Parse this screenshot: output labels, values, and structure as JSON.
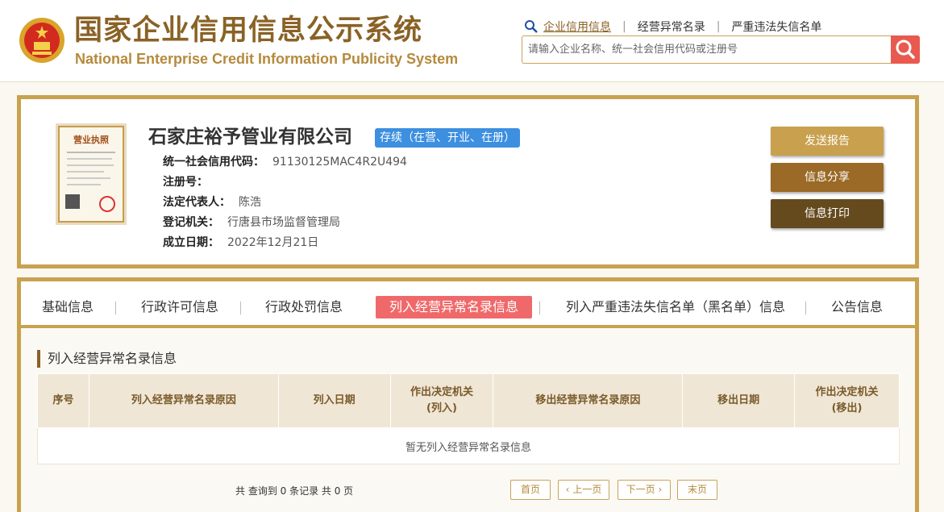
{
  "header": {
    "title_cn": "国家企业信用信息公示系统",
    "title_en": "National Enterprise Credit Information Publicity System",
    "nav": [
      "企业信用信息",
      "经营异常名录",
      "严重违法失信名单"
    ],
    "search_placeholder": "请输入企业名称、统一社会信用代码或注册号",
    "icons": {
      "emblem": "national-emblem-icon",
      "nav_search": "magnifier-icon",
      "search_button": "search-icon"
    }
  },
  "company": {
    "name": "石家庄裕予管业有限公司",
    "status": "存续（在营、开业、在册）",
    "license_image_title": "营业执照",
    "fields": [
      {
        "label": "统一社会信用代码：",
        "value": "91130125MAC4R2U494"
      },
      {
        "label": "注册号：",
        "value": ""
      },
      {
        "label": "法定代表人：",
        "value": "陈浩"
      },
      {
        "label": "登记机关：",
        "value": "行唐县市场监督管理局"
      },
      {
        "label": "成立日期：",
        "value": "2022年12月21日"
      }
    ],
    "actions": [
      {
        "label": "发送报告",
        "color": "#c9a04e"
      },
      {
        "label": "信息分享",
        "color": "#9a6a26"
      },
      {
        "label": "信息打印",
        "color": "#654a1e"
      }
    ]
  },
  "tabs": [
    {
      "label": "基础信息",
      "active": false
    },
    {
      "label": "行政许可信息",
      "active": false
    },
    {
      "label": "行政处罚信息",
      "active": false
    },
    {
      "label": "列入经营异常名录信息",
      "active": true
    },
    {
      "label": "列入严重违法失信名单（黑名单）信息",
      "active": false
    },
    {
      "label": "公告信息",
      "active": false
    }
  ],
  "abnormal_section": {
    "title": "列入经营异常名录信息",
    "columns": [
      "序号",
      "列入经营异常名录原因",
      "列入日期",
      "作出决定机关\n(列入)",
      "移出经营异常名录原因",
      "移出日期",
      "作出决定机关\n(移出)"
    ],
    "empty_text": "暂无列入经营异常名录信息",
    "pager": {
      "summary": "共 查询到 0 条记录 共 0 页",
      "first": "首页",
      "prev": "上一页",
      "next": "下一页",
      "last": "末页"
    }
  },
  "colors": {
    "brand_gold": "#c8a24f",
    "brand_brown": "#8a6226",
    "active_tab": "#f0696a",
    "status_blue": "#3d8fe0",
    "search_red": "#e85a4f"
  }
}
